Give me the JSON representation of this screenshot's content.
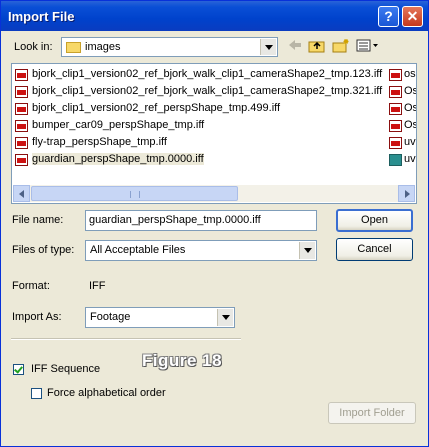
{
  "window": {
    "title": "Import File"
  },
  "title_buttons": {
    "help": "?",
    "close": "✕"
  },
  "look_in": {
    "label": "Look in:",
    "value": "images"
  },
  "toolbar": {
    "back_icon": "back-arrow-icon",
    "up_icon": "up-folder-icon",
    "new_folder_icon": "new-folder-icon",
    "views_icon": "view-menu-icon"
  },
  "files": [
    {
      "name": "bjork_clip1_version02_ref_bjork_walk_clip1_cameraShape2_tmp.123.iff",
      "icon": "iff-file-icon",
      "selected": false
    },
    {
      "name": "bjork_clip1_version02_ref_bjork_walk_clip1_cameraShape2_tmp.321.iff",
      "icon": "iff-file-icon",
      "selected": false
    },
    {
      "name": "bjork_clip1_version02_ref_perspShape_tmp.499.iff",
      "icon": "iff-file-icon",
      "selected": false
    },
    {
      "name": "bumper_car09_perspShape_tmp.iff",
      "icon": "iff-file-icon",
      "selected": false
    },
    {
      "name": "fly-trap_perspShape_tmp.iff",
      "icon": "iff-file-icon",
      "selected": false
    },
    {
      "name": "guardian_perspShape_tmp.0000.iff",
      "icon": "iff-file-icon",
      "selected": true
    }
  ],
  "files_col2": [
    {
      "name": "osc",
      "icon": "iff-file-icon"
    },
    {
      "name": "Os",
      "icon": "iff-file-icon"
    },
    {
      "name": "Os",
      "icon": "iff-file-icon"
    },
    {
      "name": "Os",
      "icon": "iff-file-icon"
    },
    {
      "name": "uv",
      "icon": "iff-file-icon"
    },
    {
      "name": "uv",
      "icon": "uv-file-icon"
    }
  ],
  "file_name": {
    "label": "File name:",
    "value": "guardian_perspShape_tmp.0000.iff"
  },
  "file_type": {
    "label": "Files of type:",
    "value": "All Acceptable Files"
  },
  "format": {
    "label": "Format:",
    "value": "IFF"
  },
  "import_as": {
    "label": "Import As:",
    "value": "Footage"
  },
  "buttons": {
    "open": "Open",
    "cancel": "Cancel",
    "import_folder": "Import Folder"
  },
  "options": {
    "iff_sequence": {
      "label": "IFF Sequence",
      "checked": true
    },
    "force_alpha": {
      "label": "Force alphabetical order",
      "checked": false
    }
  },
  "figure_label": "Figure 18"
}
